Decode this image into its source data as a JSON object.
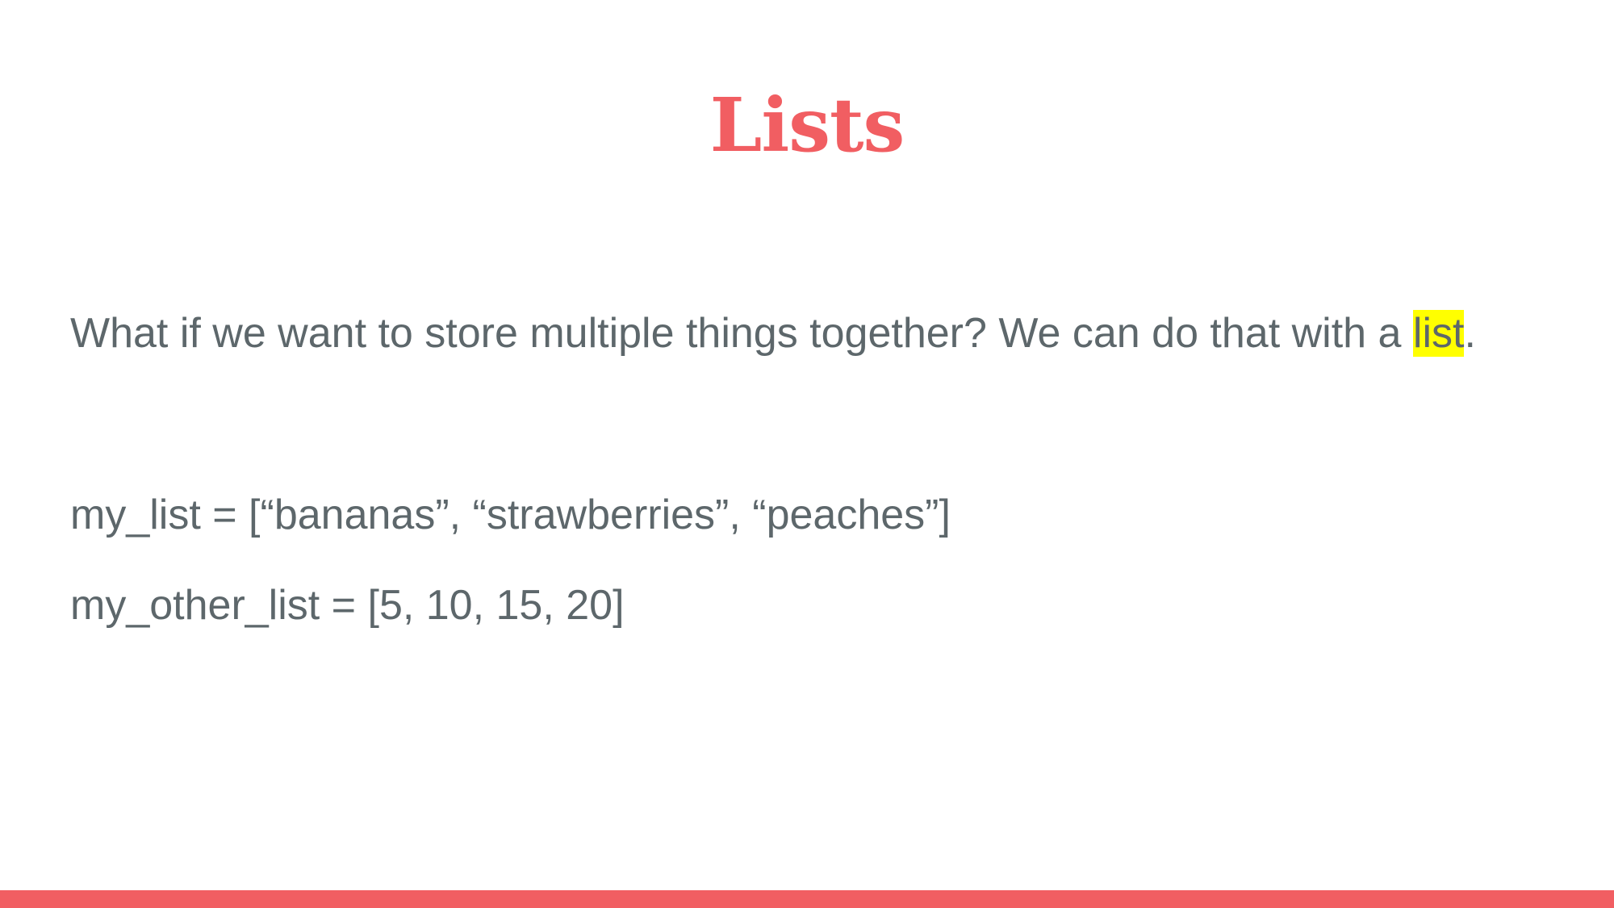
{
  "slide": {
    "title": "Lists",
    "intro": {
      "before": "What if we want to store multiple things together? We can do that with a ",
      "highlight": "list",
      "after": "."
    },
    "code_lines": [
      "my_list = [“bananas”, “strawberries”, “peaches”]",
      "my_other_list = [5, 10, 15, 20]"
    ]
  },
  "colors": {
    "accent": "#f15e62",
    "text": "#5d676b",
    "highlight": "#ffff00",
    "background": "#ffffff"
  }
}
